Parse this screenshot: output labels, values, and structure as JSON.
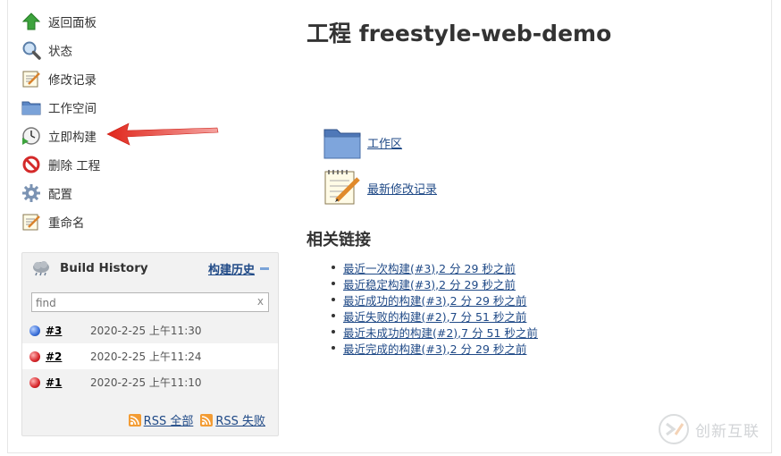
{
  "sidebar": {
    "items": [
      {
        "label": "返回面板",
        "icon": "up-arrow-icon"
      },
      {
        "label": "状态",
        "icon": "magnifier-icon"
      },
      {
        "label": "修改记录",
        "icon": "notepad-icon"
      },
      {
        "label": "工作空间",
        "icon": "folder-icon"
      },
      {
        "label": "立即构建",
        "icon": "build-clock-icon"
      },
      {
        "label": "删除 工程",
        "icon": "no-entry-icon"
      },
      {
        "label": "配置",
        "icon": "gear-icon"
      },
      {
        "label": "重命名",
        "icon": "notepad-icon"
      }
    ]
  },
  "build_history": {
    "title": "Build History",
    "trend_label": "构建历史",
    "find_placeholder": "find",
    "clear_label": "x",
    "builds": [
      {
        "number": "#3",
        "date": "2020-2-25 上午11:30",
        "status": "blue"
      },
      {
        "number": "#2",
        "date": "2020-2-25 上午11:24",
        "status": "red"
      },
      {
        "number": "#1",
        "date": "2020-2-25 上午11:10",
        "status": "red"
      }
    ],
    "rss_all": "RSS 全部",
    "rss_failed": "RSS 失败"
  },
  "main": {
    "title": "工程 freestyle-web-demo",
    "workspace_link": "工作区",
    "changes_link": "最新修改记录",
    "related_title": "相关链接",
    "permalinks": [
      "最近一次构建(#3),2 分 29 秒之前",
      "最近稳定构建(#3),2 分 29 秒之前",
      "最近成功的构建(#3),2 分 29 秒之前",
      "最近失败的构建(#2),7 分 51 秒之前",
      "最近未成功的构建(#2),7 分 51 秒之前",
      "最近完成的构建(#3),2 分 29 秒之前"
    ]
  },
  "watermark": {
    "text": "创新互联"
  },
  "colors": {
    "link": "#204a87",
    "annotation_arrow": "#e0261b",
    "status_blue": "#3a6fd8",
    "status_red": "#d7262b",
    "rss": "#f39c34"
  }
}
